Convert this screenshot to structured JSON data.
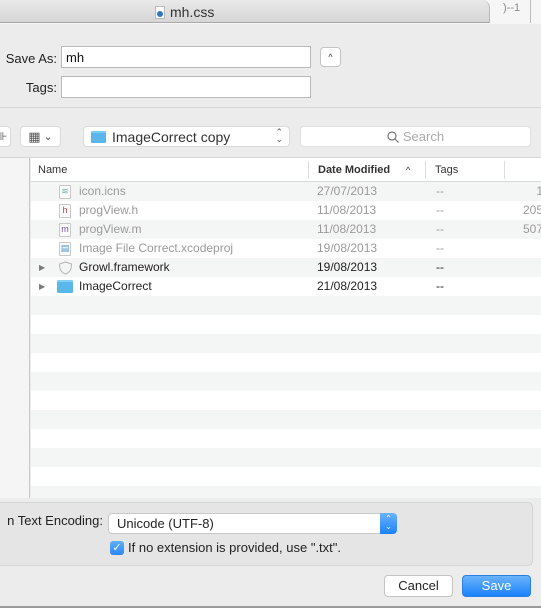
{
  "window": {
    "title": "mh.css",
    "title_icon": "css-document-icon",
    "corner_text": ")--1"
  },
  "save_form": {
    "save_as_label": "Save As:",
    "save_as_value": "mh",
    "tags_label": "Tags:",
    "tags_value": "",
    "expand_button_glyph": "^"
  },
  "toolbar": {
    "sidebar_toggle_glyph": "⊪",
    "view_mode_glyph": "▦",
    "view_mode_chevron": "⌄",
    "location": "ImageCorrect copy",
    "location_icon": "folder-icon",
    "search_placeholder": "Search",
    "search_icon": "search-icon"
  },
  "file_list": {
    "columns": [
      {
        "label": "Name"
      },
      {
        "label": "Date Modified",
        "sort": "ascending",
        "sort_glyph": "^"
      },
      {
        "label": "Tags"
      },
      {
        "label": ""
      }
    ],
    "rows": [
      {
        "name": "icon.icns",
        "icon": "icns-file-icon",
        "icon_glyph": "≋",
        "date": "27/07/2013",
        "tags": "--",
        "size": "1",
        "enabled": false,
        "expandable": false
      },
      {
        "name": "progView.h",
        "icon": "header-file-icon",
        "icon_glyph": "h",
        "date": "11/08/2013",
        "tags": "--",
        "size": "205",
        "enabled": false,
        "expandable": false
      },
      {
        "name": "progView.m",
        "icon": "objc-file-icon",
        "icon_glyph": "m",
        "date": "11/08/2013",
        "tags": "--",
        "size": "507",
        "enabled": false,
        "expandable": false
      },
      {
        "name": "Image File Correct.xcodeproj",
        "icon": "xcodeproj-icon",
        "icon_glyph": "▤",
        "date": "19/08/2013",
        "tags": "--",
        "size": "",
        "enabled": false,
        "expandable": false
      },
      {
        "name": "Growl.framework",
        "icon": "framework-icon",
        "icon_glyph": "",
        "date": "19/08/2013",
        "tags": "--",
        "size": "",
        "enabled": true,
        "expandable": true
      },
      {
        "name": "ImageCorrect",
        "icon": "folder-icon",
        "icon_glyph": "",
        "date": "21/08/2013",
        "tags": "--",
        "size": "",
        "enabled": true,
        "expandable": true
      }
    ],
    "disclosure_glyph": "▶"
  },
  "options": {
    "encoding_label": "n Text Encoding:",
    "encoding_value": "Unicode (UTF-8)",
    "encoding_arrows": "⌃⌄",
    "extension_checkbox_checked": true,
    "check_glyph": "✓",
    "extension_checkbox_label": "If no extension is provided, use \".txt\"."
  },
  "buttons": {
    "cancel": "Cancel",
    "save": "Save"
  },
  "colors": {
    "accent": "#1a82fb",
    "folder": "#5bb7ea",
    "header_file": "#c0474f",
    "objc_file": "#7a5aa0"
  }
}
